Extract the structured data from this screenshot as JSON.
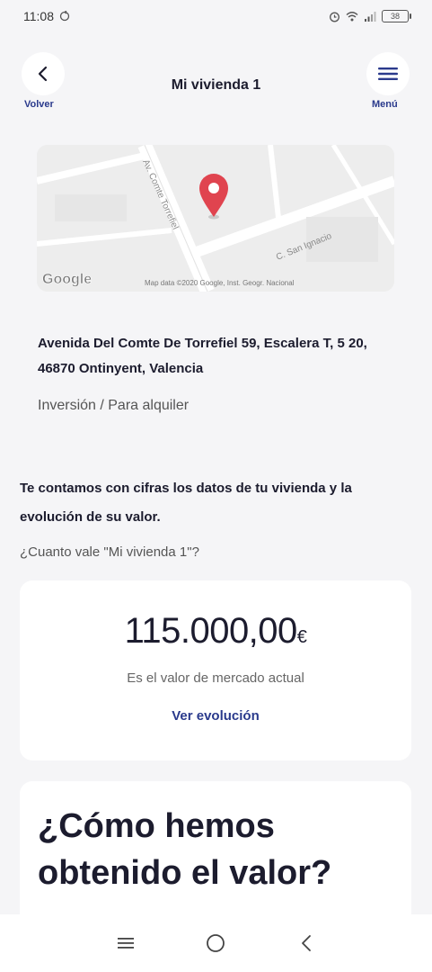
{
  "status_bar": {
    "time": "11:08",
    "battery": "38"
  },
  "header": {
    "title": "Mi vivienda 1",
    "back_label": "Volver",
    "menu_label": "Menú"
  },
  "map": {
    "street_1": "Av. Comte Torrefiel",
    "street_2": "C. San Ignacio",
    "logo": "Google",
    "attribution": "Map data ©2020 Google, Inst. Geogr. Nacional"
  },
  "property": {
    "address": "Avenida Del Comte De Torrefiel 59, Escalera T, 5 20, 46870 Ontinyent, Valencia",
    "type": "Inversión / Para alquiler"
  },
  "valuation": {
    "intro": "Te contamos con cifras los datos de tu vivienda y la evolución de su valor.",
    "question": "¿Cuanto vale \"Mi vivienda 1\"?",
    "amount": "115.000,00",
    "currency": "€",
    "caption": "Es el valor de mercado actual",
    "evolution_link": "Ver evolución"
  },
  "how": {
    "title": "¿Cómo hemos obtenido el valor?"
  },
  "colors": {
    "accent": "#2a3a8c",
    "pin": "#e0444f",
    "background": "#f5f5f7"
  }
}
